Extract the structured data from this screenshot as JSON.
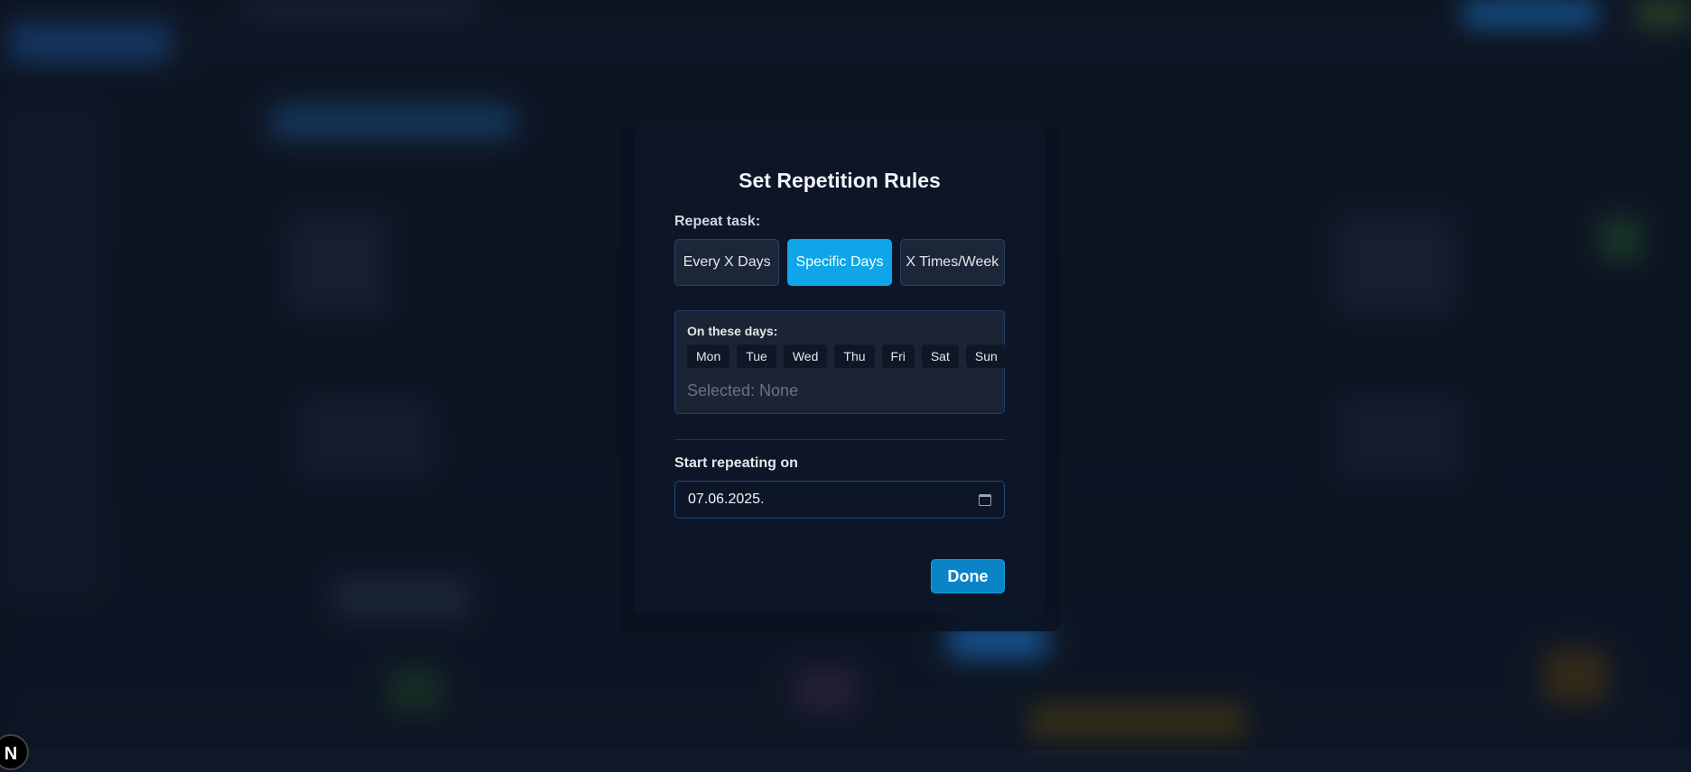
{
  "modal": {
    "title": "Set Repetition Rules",
    "repeat_label": "Repeat task:",
    "modes": [
      {
        "label": "Every X Days",
        "active": false
      },
      {
        "label": "Specific Days",
        "active": true
      },
      {
        "label": "X Times/Week",
        "active": false
      }
    ],
    "days_label": "On these days:",
    "days": [
      "Mon",
      "Tue",
      "Wed",
      "Thu",
      "Fri",
      "Sat",
      "Sun"
    ],
    "selected_text": "Selected: None",
    "start_label": "Start repeating on",
    "start_date": "07.06.2025.",
    "date_icon": "calendar-icon",
    "done_label": "Done"
  },
  "background": {
    "avatar_letter": "N"
  },
  "colors": {
    "accent": "#0ea5e9",
    "done": "#0a84c6",
    "modal_bg": "#0d1627",
    "page_bg": "#0f1829"
  }
}
